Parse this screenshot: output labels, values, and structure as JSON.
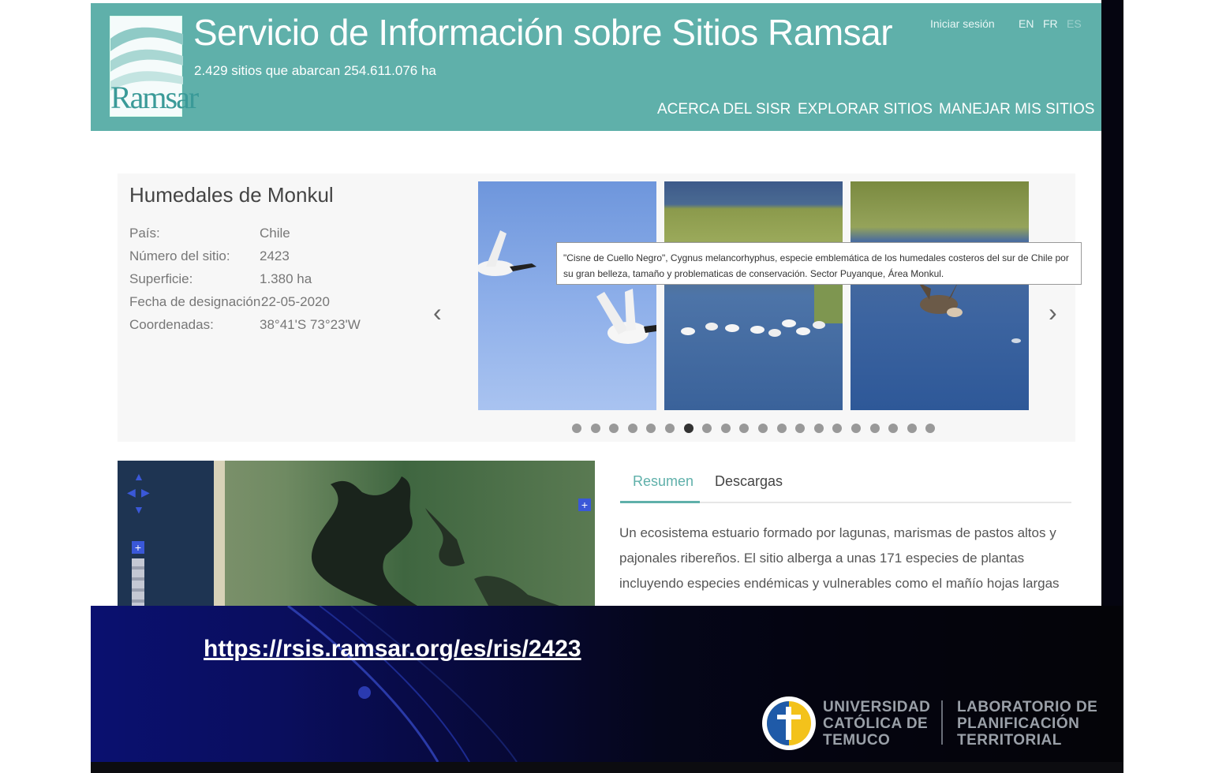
{
  "header": {
    "title": "Servicio de Información sobre Sitios Ramsar",
    "subtitle": "2.429 sitios que abarcan 254.611.076 ha",
    "logo_text": "Ramsar",
    "login": "Iniciar sesión",
    "languages": [
      "EN",
      "FR",
      "ES"
    ],
    "active_language": "ES",
    "nav": [
      "ACERCA DEL SISR",
      "EXPLORAR SITIOS",
      "MANEJAR MIS SITIOS"
    ],
    "color": "#5fb0aa"
  },
  "site": {
    "name": "Humedales de Monkul",
    "fields": [
      {
        "label": "País:",
        "value": "Chile"
      },
      {
        "label": "Número del sitio:",
        "value": "2423"
      },
      {
        "label": "Superficie:",
        "value": "1.380 ha"
      },
      {
        "label": "Fecha de designación:",
        "value": "22-05-2020"
      },
      {
        "label": "Coordenadas:",
        "value": "38°41'S 73°23'W"
      }
    ]
  },
  "carousel": {
    "prev": "‹",
    "next": "›",
    "tooltip": "\"Cisne de Cuello Negro\", Cygnus melancorhyphus, especie emblemática de los humedales costeros del sur de Chile por su gran belleza, tamaño y problematicas de conservación. Sector Puyanque, Área Monkul.",
    "dot_count": 20,
    "active_dot": 6
  },
  "tabs": [
    "Resumen",
    "Descargas"
  ],
  "active_tab": "Resumen",
  "summary": "Un ecosistema estuario formado por lagunas, marismas de pastos altos y pajonales ribereños.  El sitio alberga a unas 171 especies de plantas incluyendo especies endémicas y vulnerables como el mañío hojas largas",
  "slide": {
    "url": "https://rsis.ramsar.org/es/ris/2423",
    "university": [
      "UNIVERSIDAD",
      "CATÓLICA DE",
      "TEMUCO"
    ],
    "lab": [
      "LABORATORIO DE",
      "PLANIFICACIÓN",
      "TERRITORIAL"
    ]
  }
}
